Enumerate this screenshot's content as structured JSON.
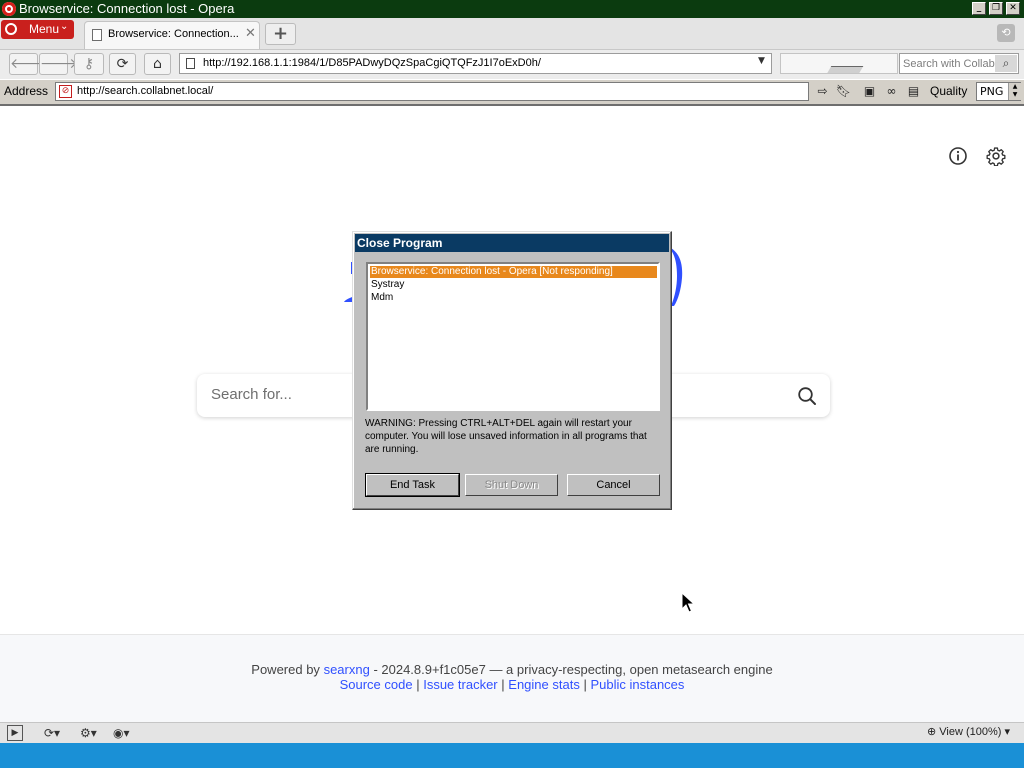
{
  "window": {
    "title": "Browservice: Connection lost - Opera",
    "controls": {
      "minimize": "_",
      "restore": "❐",
      "close": "✕"
    }
  },
  "tabbar": {
    "menu_label": "Menu",
    "tab_title": "Browservice: Connection...",
    "tab_close": "✕",
    "new_tab": "+"
  },
  "toolbar": {
    "url": "http://192.168.1.1:1984/1/D85PADwyDQzSpaCgiQTQFzJ1I7oExD0h/",
    "search_placeholder": "Search with Collab'",
    "icons": [
      "back-icon",
      "forward-icon",
      "key-icon",
      "reload-icon",
      "home-icon"
    ]
  },
  "addressbar": {
    "label": "Address",
    "url": "http://search.collabnet.local/",
    "quality_label": "Quality",
    "quality_value": "PNG"
  },
  "page": {
    "search_placeholder": "Search for...",
    "footer": {
      "powered_prefix": "Powered by",
      "powered_link": "searxng",
      "powered_suffix": "- 2024.8.9+f1c05e7 — a privacy-respecting, open metasearch engine",
      "links": [
        "Source code",
        "Issue tracker",
        "Engine stats",
        "Public instances"
      ],
      "sep": "|"
    }
  },
  "dialog": {
    "title": "Close Program",
    "processes": [
      {
        "name": "Browservice: Connection lost - Opera [Not responding]",
        "selected": true
      },
      {
        "name": "Systray",
        "selected": false
      },
      {
        "name": "Mdm",
        "selected": false
      }
    ],
    "warning": "WARNING: Pressing CTRL+ALT+DEL again will restart your computer. You will lose unsaved information in all programs that are running.",
    "buttons": {
      "end_task": "End Task",
      "shut_down": "Shut Down",
      "cancel": "Cancel"
    }
  },
  "statusbar": {
    "zoom": "View (100%)"
  },
  "colors": {
    "title_bg": "#0b3b0f",
    "menu_red": "#c9201d",
    "dialog_caption": "#0a3a63",
    "selection": "#e8881c",
    "link": "#3050ff",
    "taskbar": "#1a90d6"
  }
}
